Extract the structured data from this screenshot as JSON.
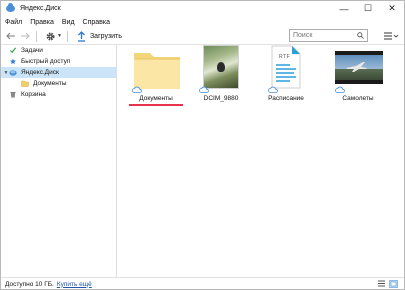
{
  "window": {
    "title": "Яндекс.Диск",
    "controls": [
      "—",
      "☐",
      "✕"
    ]
  },
  "menu": [
    "Файл",
    "Правка",
    "Вид",
    "Справка"
  ],
  "toolbar": {
    "upload_label": "Загрузить",
    "search_placeholder": "Поиск"
  },
  "sidebar": {
    "items": [
      {
        "label": "Задачи",
        "icon": "tasks-icon"
      },
      {
        "label": "Быстрый доступ",
        "icon": "star-icon"
      },
      {
        "label": "Яндекс.Диск",
        "icon": "yandex-disk-icon",
        "selected": true
      },
      {
        "label": "Документы",
        "icon": "folder-icon"
      },
      {
        "label": "Корзина",
        "icon": "trash-icon"
      }
    ]
  },
  "files": [
    {
      "label": "Документы",
      "type": "folder"
    },
    {
      "label": "DCIM_9880",
      "type": "photo"
    },
    {
      "label": "Расписание",
      "type": "rtf",
      "badge": "RTF"
    },
    {
      "label": "Самолеты",
      "type": "video"
    }
  ],
  "status": {
    "text": "Доступно 10 ГБ.",
    "link": "Купить ещё"
  },
  "colors": {
    "accent": "#cce4f7",
    "underline": "#e8334a",
    "link": "#2255aa",
    "cloud": "#4a90d9"
  }
}
